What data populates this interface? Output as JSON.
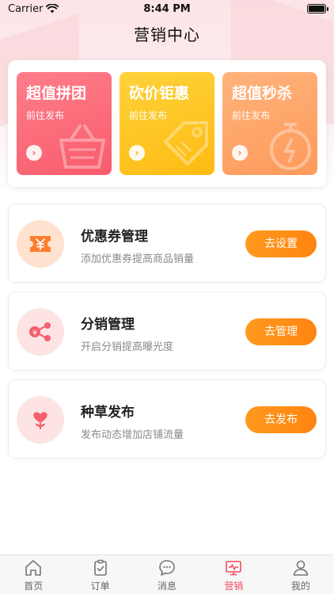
{
  "status_bar": {
    "carrier": "Carrier",
    "time": "8:44 PM"
  },
  "nav": {
    "title": "营销中心"
  },
  "promos": [
    {
      "title": "超值拼团",
      "subtitle": "前往发布",
      "icon": "basket-icon"
    },
    {
      "title": "砍价钜惠",
      "subtitle": "前往发布",
      "icon": "price-tag-icon"
    },
    {
      "title": "超值秒杀",
      "subtitle": "前往发布",
      "icon": "stopwatch-icon"
    }
  ],
  "cards": [
    {
      "title": "优惠券管理",
      "subtitle": "添加优惠券提高商品销量",
      "button": "去设置",
      "icon": "coupon-icon"
    },
    {
      "title": "分销管理",
      "subtitle": "开启分销提高曝光度",
      "button": "去管理",
      "icon": "share-icon"
    },
    {
      "title": "种草发布",
      "subtitle": "发布动态增加店铺流量",
      "button": "去发布",
      "icon": "heart-flower-icon"
    }
  ],
  "tabs": [
    {
      "label": "首页",
      "icon": "home-icon"
    },
    {
      "label": "订单",
      "icon": "clipboard-icon"
    },
    {
      "label": "消息",
      "icon": "chat-icon"
    },
    {
      "label": "营销",
      "icon": "monitor-chart-icon",
      "active": true
    },
    {
      "label": "我的",
      "icon": "user-icon"
    }
  ],
  "colors": {
    "accent": "#f6495b",
    "button": "#ff8c14",
    "promo_red": "#f95c6c",
    "promo_yellow": "#fdbb13",
    "promo_orange": "#fe9a5b"
  }
}
